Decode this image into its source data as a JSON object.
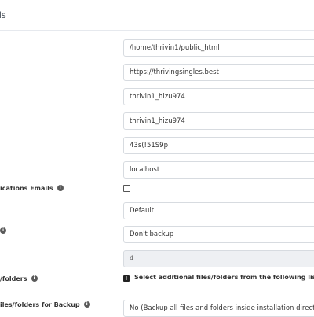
{
  "header": {
    "title": "ls"
  },
  "fields": {
    "install_path": "/home/thrivin1/public_html",
    "site_url": "https://thrivingsingles.best",
    "db_name": "thrivin1_hizu974",
    "db_user": "thrivin1_hizu974",
    "db_password": "43s(!51S9p",
    "db_host": "localhost",
    "select_default": "Default",
    "backup_select": "Don't backup",
    "backup_count": "4",
    "exclude_select": "No (Backup all files and folders inside installation directory e"
  },
  "labels": {
    "notifications": "ications Emails",
    "backup": "",
    "files_folders": "/folders",
    "files_for_backup": "iles/folders for Backup"
  },
  "add_files": {
    "label": "Select additional files/folders from the following list"
  },
  "icons": {
    "info": "i",
    "plus": "+"
  },
  "colors": {
    "border": "#d7dbe0",
    "disabled_bg": "#eef0f3",
    "text": "#333333"
  }
}
